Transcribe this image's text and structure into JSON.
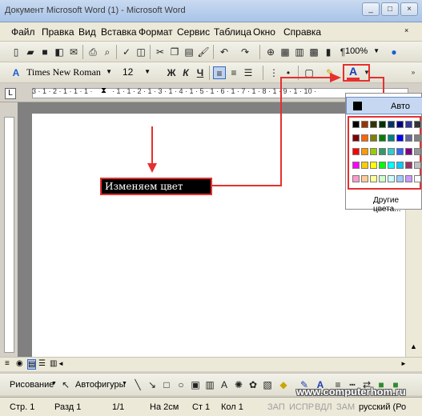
{
  "window": {
    "title": "Документ Microsoft Word (1) - Microsoft Word"
  },
  "menu": [
    "Файл",
    "Правка",
    "Вид",
    "Вставка",
    "Формат",
    "Сервис",
    "Таблица",
    "Окно",
    "Справка"
  ],
  "standard_toolbar": {
    "zoom": "100%"
  },
  "formatting_toolbar": {
    "font_name": "Times New Roman",
    "font_size": "12",
    "bold": "Ж",
    "italic": "К",
    "underline": "Ч",
    "font_color_glyph": "A"
  },
  "color_popup": {
    "auto_label": "Авто",
    "more_label": "Другие цвета...",
    "palette": [
      [
        "#000000",
        "#993300",
        "#333300",
        "#003300",
        "#003366",
        "#000080",
        "#333399",
        "#333333"
      ],
      [
        "#800000",
        "#ff6600",
        "#808000",
        "#008000",
        "#008080",
        "#0000ff",
        "#666699",
        "#808080"
      ],
      [
        "#ff0000",
        "#ff9900",
        "#99cc00",
        "#339966",
        "#33cccc",
        "#3366ff",
        "#800080",
        "#969696"
      ],
      [
        "#ff00ff",
        "#ffcc00",
        "#ffff00",
        "#00ff00",
        "#00ffff",
        "#00ccff",
        "#993366",
        "#c0c0c0"
      ],
      [
        "#ff99cc",
        "#ffcc99",
        "#ffff99",
        "#ccffcc",
        "#ccffff",
        "#99ccff",
        "#cc99ff",
        "#ffffff"
      ]
    ]
  },
  "annotation": {
    "text": "Изменяем цвет шрифта",
    "accent_color": "#e5302f"
  },
  "drawing_toolbar": {
    "draw_label": "Рисование",
    "autoshapes_label": "Автофигуры"
  },
  "statusbar": {
    "page": "Стр. 1",
    "section": "Разд 1",
    "pages": "1/1",
    "at": "На 2см",
    "line": "Ст 1",
    "col": "Кол 1",
    "rec": "ЗАП",
    "trk": "ИСПР",
    "ext": "ВДЛ",
    "ovr": "ЗАМ",
    "lang": "русский (Ро"
  },
  "watermark": "www.computerhom.ru"
}
